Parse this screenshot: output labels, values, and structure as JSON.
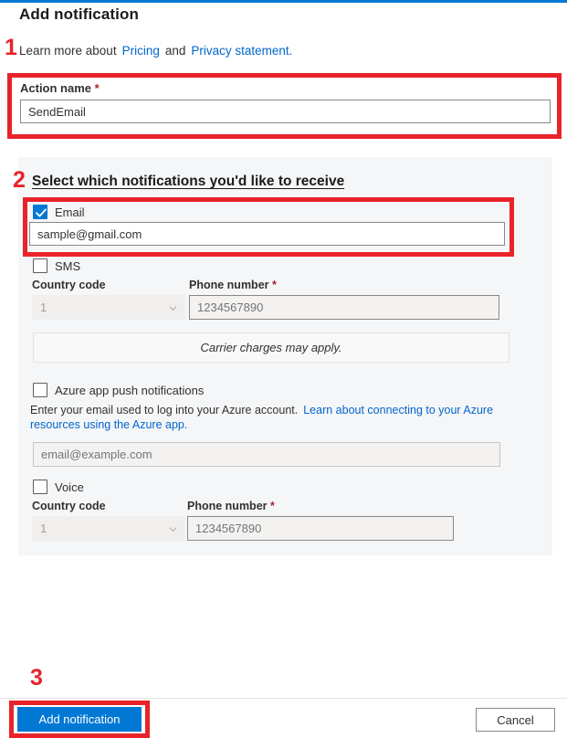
{
  "accent_colors": {
    "brand_blue": "#0078d4",
    "link_blue": "#0066cc",
    "annotation_red": "#e8232a",
    "required_red": "#a4262c",
    "panel_gray": "#f5f6f8"
  },
  "header": {
    "title": "Add notification",
    "learn_prefix": "Learn more about",
    "pricing_link": "Pricing",
    "conjunction": "and",
    "privacy_link": "Privacy statement."
  },
  "annotations": {
    "step_one": "1",
    "step_two": "2",
    "step_three": "3"
  },
  "action_name": {
    "label": "Action name",
    "required_mark": "*",
    "value": "SendEmail"
  },
  "notifications": {
    "section_heading": "Select which notifications you'd like to receive",
    "email": {
      "checkbox_label": "Email",
      "checked": true,
      "value": "sample@gmail.com",
      "placeholder": "sample@gmail.com"
    },
    "sms": {
      "checkbox_label": "SMS",
      "checked": false,
      "country_code_label": "Country code",
      "country_code_value": "1",
      "phone_label": "Phone number",
      "phone_required_mark": "*",
      "phone_placeholder": "1234567890",
      "carrier_note": "Carrier charges may apply."
    },
    "push": {
      "checkbox_label": "Azure app push notifications",
      "checked": false,
      "description_text": "Enter your email used to log into your Azure account.",
      "description_link": "Learn about connecting to your Azure resources using the Azure app.",
      "email_placeholder": "email@example.com"
    },
    "voice": {
      "checkbox_label": "Voice",
      "checked": false,
      "country_code_label": "Country code",
      "country_code_value": "1",
      "phone_label": "Phone number",
      "phone_required_mark": "*",
      "phone_placeholder": "1234567890"
    }
  },
  "footer": {
    "primary_label": "Add notification",
    "secondary_label": "Cancel"
  }
}
